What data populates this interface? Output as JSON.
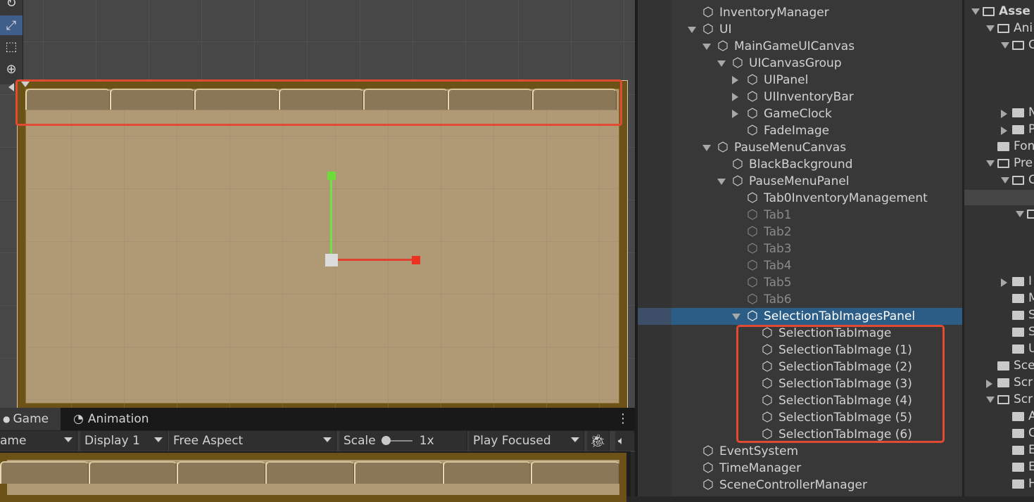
{
  "scene": {
    "tab_count": 7
  },
  "game_window": {
    "tabs": [
      {
        "label": "Game",
        "icon": "game-controller-icon"
      },
      {
        "label": "Animation",
        "icon": "clock-icon"
      }
    ],
    "toolbar": {
      "display_mode": "ame",
      "display": "Display 1",
      "aspect": "Free Aspect",
      "scale_label": "Scale",
      "scale_value": "1x",
      "play_mode": "Play Focused"
    }
  },
  "hierarchy": {
    "items": [
      {
        "label": "InventoryManager",
        "arrow": "",
        "dim": false
      },
      {
        "label": "UI",
        "arrow": "down",
        "dim": false
      },
      {
        "label": "MainGameUICanvas",
        "arrow": "down",
        "dim": false
      },
      {
        "label": "UICanvasGroup",
        "arrow": "down",
        "dim": false
      },
      {
        "label": "UIPanel",
        "arrow": "right",
        "dim": false
      },
      {
        "label": "UIInventoryBar",
        "arrow": "right",
        "dim": false
      },
      {
        "label": "GameClock",
        "arrow": "right",
        "dim": false
      },
      {
        "label": "FadeImage",
        "arrow": "",
        "dim": false
      },
      {
        "label": "PauseMenuCanvas",
        "arrow": "down",
        "dim": false
      },
      {
        "label": "BlackBackground",
        "arrow": "",
        "dim": false
      },
      {
        "label": "PauseMenuPanel",
        "arrow": "down",
        "dim": false
      },
      {
        "label": "Tab0InventoryManagement",
        "arrow": "",
        "dim": false
      },
      {
        "label": "Tab1",
        "arrow": "",
        "dim": true
      },
      {
        "label": "Tab2",
        "arrow": "",
        "dim": true
      },
      {
        "label": "Tab3",
        "arrow": "",
        "dim": true
      },
      {
        "label": "Tab4",
        "arrow": "",
        "dim": true
      },
      {
        "label": "Tab5",
        "arrow": "",
        "dim": true
      },
      {
        "label": "Tab6",
        "arrow": "",
        "dim": true
      },
      {
        "label": "SelectionTabImagesPanel",
        "arrow": "down",
        "dim": false,
        "selected": true
      },
      {
        "label": "SelectionTabImage",
        "arrow": "",
        "dim": false
      },
      {
        "label": "SelectionTabImage (1)",
        "arrow": "",
        "dim": false
      },
      {
        "label": "SelectionTabImage (2)",
        "arrow": "",
        "dim": false
      },
      {
        "label": "SelectionTabImage (3)",
        "arrow": "",
        "dim": false
      },
      {
        "label": "SelectionTabImage (4)",
        "arrow": "",
        "dim": false
      },
      {
        "label": "SelectionTabImage (5)",
        "arrow": "",
        "dim": false
      },
      {
        "label": "SelectionTabImage (6)",
        "arrow": "",
        "dim": false
      },
      {
        "label": "EventSystem",
        "arrow": "",
        "dim": false
      },
      {
        "label": "TimeManager",
        "arrow": "",
        "dim": false
      },
      {
        "label": "SceneControllerManager",
        "arrow": "",
        "dim": false
      }
    ]
  },
  "project": {
    "items": [
      {
        "label": "Asse",
        "arrow": "down",
        "open": true,
        "bold": true
      },
      {
        "label": "Ani",
        "arrow": "down",
        "open": true
      },
      {
        "label": "C",
        "arrow": "down",
        "open": true
      },
      {
        "label": "",
        "arrow": "",
        "open": false
      },
      {
        "label": "",
        "arrow": "",
        "open": false
      },
      {
        "label": "",
        "arrow": "",
        "open": false
      },
      {
        "label": "N",
        "arrow": "right",
        "open": false
      },
      {
        "label": "P",
        "arrow": "right",
        "open": false
      },
      {
        "label": "Fon",
        "arrow": "",
        "open": false
      },
      {
        "label": "Pre",
        "arrow": "down",
        "open": true
      },
      {
        "label": "C",
        "arrow": "down",
        "open": true
      },
      {
        "label": "",
        "arrow": "",
        "open": false
      },
      {
        "label": "",
        "arrow": "down",
        "open": true
      },
      {
        "label": "",
        "arrow": "",
        "open": false
      },
      {
        "label": "",
        "arrow": "",
        "open": false
      },
      {
        "label": "",
        "arrow": "",
        "open": false
      },
      {
        "label": "I",
        "arrow": "right",
        "open": false
      },
      {
        "label": "M",
        "arrow": "",
        "open": false
      },
      {
        "label": "S",
        "arrow": "",
        "open": false
      },
      {
        "label": "S",
        "arrow": "",
        "open": false
      },
      {
        "label": "U",
        "arrow": "",
        "open": false
      },
      {
        "label": "Sce",
        "arrow": "",
        "open": false
      },
      {
        "label": "Scr",
        "arrow": "right",
        "open": false
      },
      {
        "label": "Scr",
        "arrow": "down",
        "open": true
      },
      {
        "label": "A",
        "arrow": "",
        "open": false
      },
      {
        "label": "C",
        "arrow": "",
        "open": false
      },
      {
        "label": "E",
        "arrow": "",
        "open": false
      },
      {
        "label": "E",
        "arrow": "",
        "open": false
      },
      {
        "label": "H",
        "arrow": "",
        "open": false
      }
    ]
  }
}
